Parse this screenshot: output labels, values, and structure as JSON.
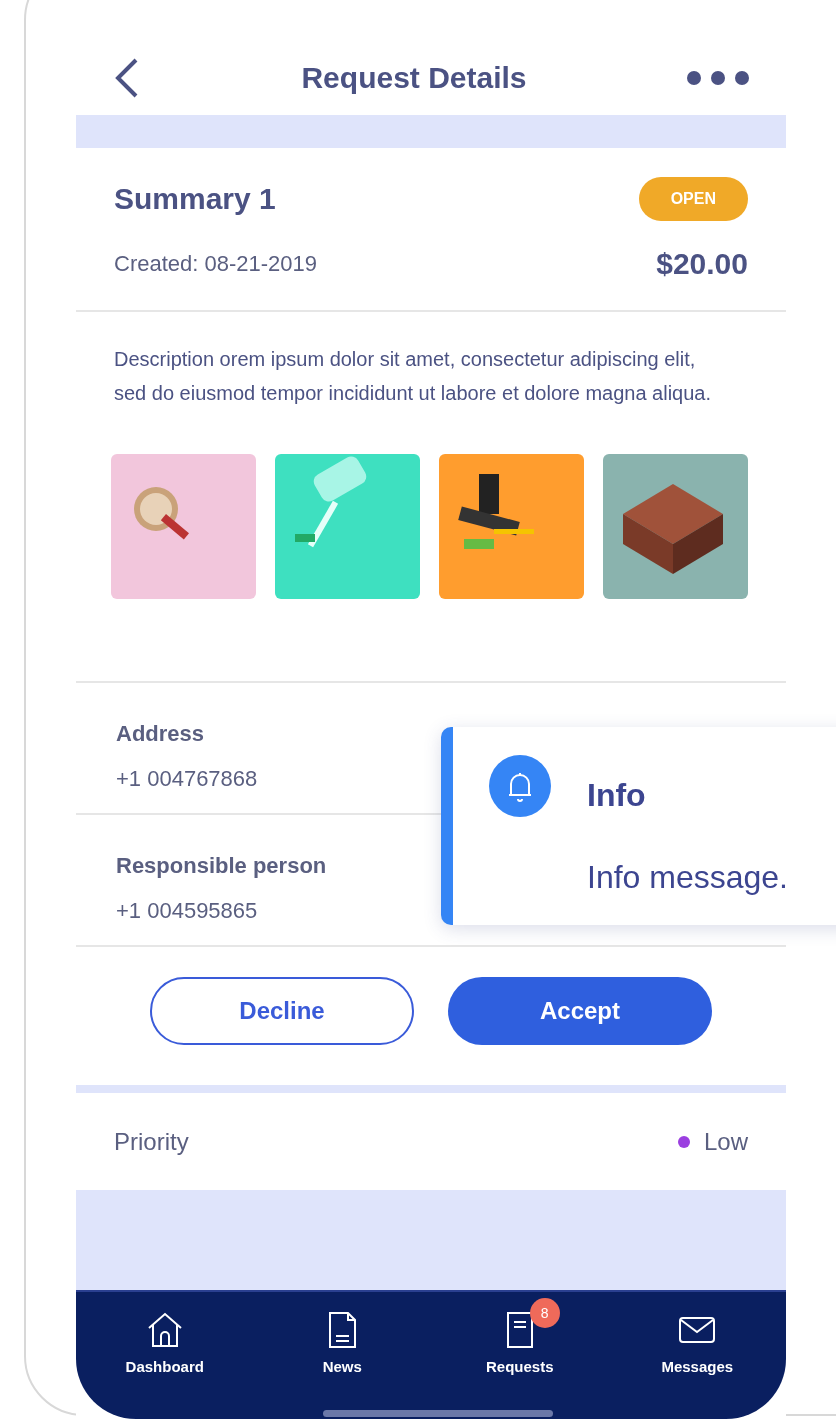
{
  "header": {
    "title": "Request Details"
  },
  "summary": {
    "title": "Summary 1",
    "status": "OPEN",
    "created": "Created: 08-21-2019",
    "price": "$20.00"
  },
  "description": "Description orem ipsum dolor sit amet, consectetur adipiscing elit, sed do eiusmod tempor incididunt ut labore et dolore magna aliqua.",
  "fields": [
    {
      "label": "Address",
      "value": "+1 004767868"
    },
    {
      "label": "Responsible person",
      "value": "+1 004595865"
    }
  ],
  "buttons": {
    "decline": "Decline",
    "accept": "Accept"
  },
  "priority": {
    "label": "Priority",
    "value": "Low"
  },
  "toast": {
    "title": "Info",
    "message": "Info message."
  },
  "nav": [
    {
      "label": "Dashboard"
    },
    {
      "label": "News"
    },
    {
      "label": "Requests",
      "badge": "8"
    },
    {
      "label": "Messages"
    }
  ]
}
